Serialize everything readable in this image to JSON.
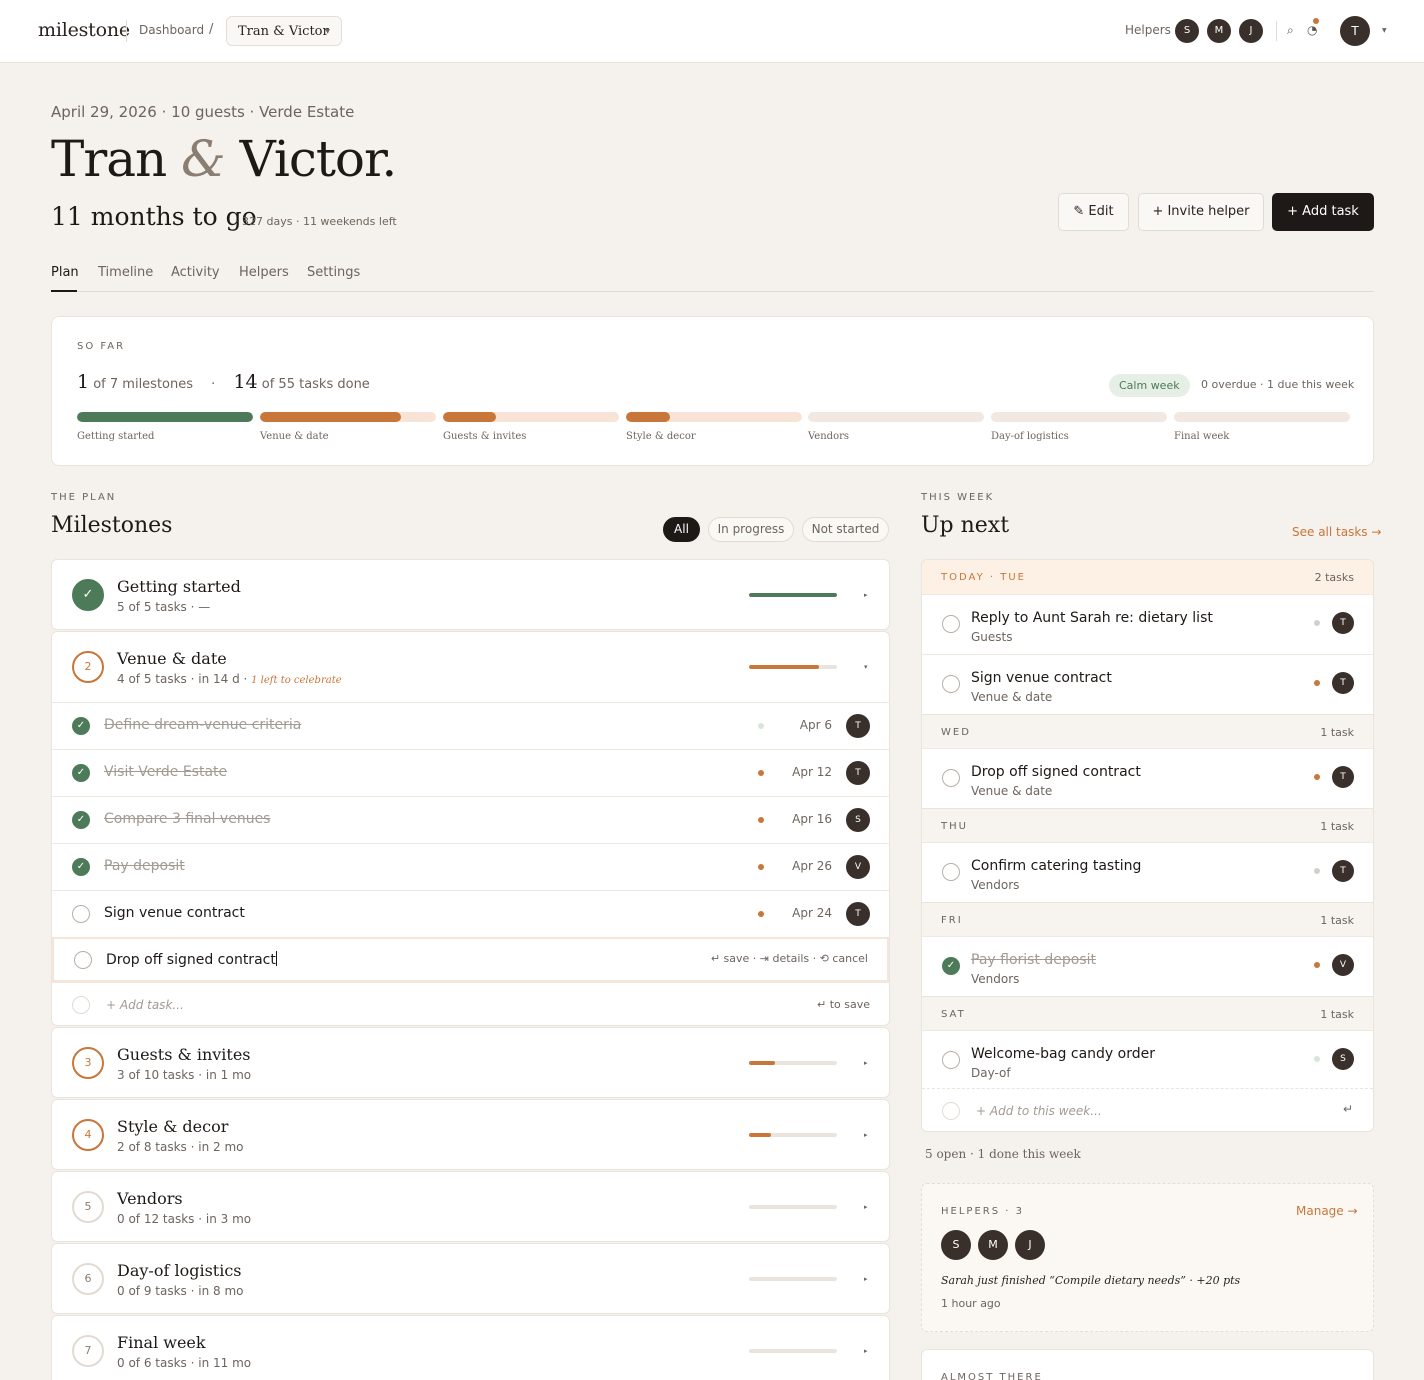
{
  "topbar": {
    "logo": "milestone",
    "crumb_dashboard": "Dashboard",
    "crumb_slash": "/",
    "crumb_event": "Tran & Victor",
    "helpers_label": "Helpers",
    "helpers": [
      "S",
      "M",
      "J"
    ],
    "search_icon": "⌕",
    "bell_icon": "◔",
    "user_initial": "T"
  },
  "header": {
    "meta": "April 29, 2026 · 10 guests · Verde Estate",
    "name1": "Tran",
    "amp": "&",
    "name2": "Victor.",
    "countdown": "11 months to go",
    "countdown_sub": "· 327 days · 11 weekends left",
    "edit_label": "✎ Edit",
    "invite_label": "+ Invite helper",
    "add_task_label": "+ Add task"
  },
  "tabs": [
    "Plan",
    "Timeline",
    "Activity",
    "Helpers",
    "Settings"
  ],
  "summary": {
    "eyebrow": "SO FAR",
    "milestones_big": "1",
    "milestones_text": " of 7 milestones",
    "dot": "·",
    "tasks_big": "14",
    "tasks_text": " of 55 tasks done",
    "calm": "Calm week",
    "overdue": "0 overdue · 1 due this week",
    "phases": [
      {
        "label": "Getting started",
        "progress": 1.0,
        "color": "#4d7a59",
        "track": "neutral"
      },
      {
        "label": "Venue & date",
        "progress": 0.8,
        "color": "#c8763a",
        "track": "peach"
      },
      {
        "label": "Guests & invites",
        "progress": 0.3,
        "color": "#c8763a",
        "track": "peach"
      },
      {
        "label": "Style & decor",
        "progress": 0.25,
        "color": "#c8763a",
        "track": "peach"
      },
      {
        "label": "Vendors",
        "progress": 0,
        "color": "#c8763a",
        "track": "neutral"
      },
      {
        "label": "Day-of logistics",
        "progress": 0,
        "color": "#c8763a",
        "track": "neutral"
      },
      {
        "label": "Final week",
        "progress": 0,
        "color": "#c8763a",
        "track": "neutral"
      }
    ]
  },
  "plan": {
    "eyebrow": "THE PLAN",
    "title": "Milestones",
    "filters": [
      "All",
      "In progress",
      "Not started"
    ],
    "m1": {
      "badge": "✓",
      "title": "Getting started",
      "sub": "5 of 5 tasks · —",
      "progress": 1.0,
      "color": "#4d7a59"
    },
    "m2": {
      "badge": "2",
      "title": "Venue & date",
      "sub": "4 of 5 tasks · in 14 d · ",
      "note": "1 left to celebrate",
      "progress": 0.8,
      "color": "#c8763a"
    },
    "tasks": [
      {
        "label": "Define dream-venue criteria",
        "date": "Apr 6",
        "who": "T",
        "done": true,
        "dot": "light"
      },
      {
        "label": "Visit Verde Estate",
        "date": "Apr 12",
        "who": "T",
        "done": true,
        "dot": "orange"
      },
      {
        "label": "Compare 3 final venues",
        "date": "Apr 16",
        "who": "S",
        "done": true,
        "dot": "orange"
      },
      {
        "label": "Pay deposit",
        "date": "Apr 26",
        "who": "V",
        "done": true,
        "dot": "orange"
      },
      {
        "label": "Sign venue contract",
        "date": "Apr 24",
        "who": "T",
        "done": false,
        "dot": "orange"
      }
    ],
    "edit_value": "Drop off signed contract",
    "edit_hint": "↵ save · ⇥ details · ⟲ cancel",
    "add_task": "+ Add task...",
    "add_hint": "↵ to save",
    "m3": {
      "badge": "3",
      "title": "Guests & invites",
      "sub": "3 of 10 tasks · in 1 mo",
      "progress": 0.3,
      "color": "#c8763a"
    },
    "m4": {
      "badge": "4",
      "title": "Style & decor",
      "sub": "2 of 8 tasks · in 2 mo",
      "progress": 0.25,
      "color": "#c8763a"
    },
    "m5": {
      "badge": "5",
      "title": "Vendors",
      "sub": "0 of 12 tasks · in 3 mo",
      "progress": 0,
      "color": "#c8763a"
    },
    "m6": {
      "badge": "6",
      "title": "Day-of logistics",
      "sub": "0 of 9 tasks · in 8 mo",
      "progress": 0,
      "color": "#c8763a"
    },
    "m7": {
      "badge": "7",
      "title": "Final week",
      "sub": "0 of 6 tasks · in 11 mo",
      "progress": 0,
      "color": "#c8763a"
    },
    "caret": "▸",
    "caret_open": "▾"
  },
  "week": {
    "eyebrow": "THIS WEEK",
    "title": "Up next",
    "see_all": "See all tasks →",
    "today": {
      "name": "TODAY · TUE",
      "count": "2 tasks"
    },
    "t1": {
      "title": "Reply to Aunt Sarah re: dietary list",
      "sub": "Guests",
      "who": "T"
    },
    "t2": {
      "title": "Sign venue contract",
      "sub": "Venue & date",
      "who": "T"
    },
    "wed": {
      "name": "WED",
      "count": "1 task"
    },
    "t3": {
      "title": "Drop off signed contract",
      "sub": "Venue & date",
      "who": "T"
    },
    "thu": {
      "name": "THU",
      "count": "1 task"
    },
    "t4": {
      "title": "Confirm catering tasting",
      "sub": "Vendors",
      "who": "T"
    },
    "fri": {
      "name": "FRI",
      "count": "1 task"
    },
    "t5": {
      "title": "Pay florist deposit",
      "sub": "Vendors",
      "who": "V"
    },
    "sat": {
      "name": "SAT",
      "count": "1 task"
    },
    "t6": {
      "title": "Welcome-bag candy order",
      "sub": "Day-of",
      "who": "S"
    },
    "add": "+ Add to this week...",
    "enter": "↵",
    "footer": "5 open · 1 done this week"
  },
  "helpers_card": {
    "eyebrow": "HELPERS · 3",
    "manage": "Manage →",
    "people": [
      "S",
      "M",
      "J"
    ],
    "activity": "Sarah just finished “Compile dietary needs” · +20 pts",
    "ago": "1 hour ago"
  },
  "almost": {
    "eyebrow": "ALMOST THERE"
  }
}
